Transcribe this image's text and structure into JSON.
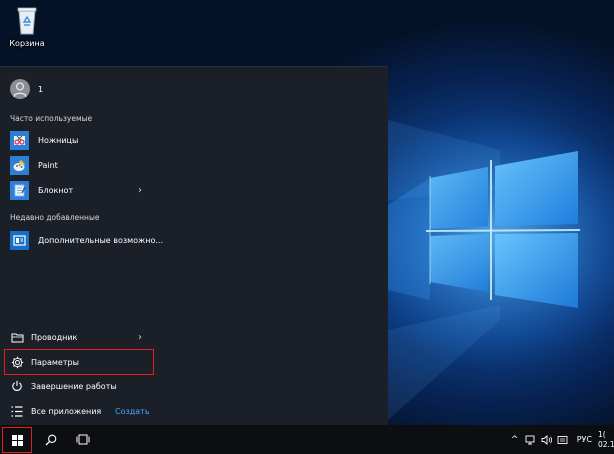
{
  "desktop": {
    "recycle_bin_label": "Корзина"
  },
  "start_menu": {
    "user_name": "1",
    "frequent": {
      "heading": "Часто используемые",
      "items": [
        {
          "label": "Ножницы",
          "icon": "scissors-icon",
          "has_submenu": false
        },
        {
          "label": "Paint",
          "icon": "paint-icon",
          "has_submenu": false
        },
        {
          "label": "Блокнот",
          "icon": "notepad-icon",
          "has_submenu": true
        }
      ]
    },
    "recent": {
      "heading": "Недавно добавленные",
      "items": [
        {
          "label": "Дополнительные возможно...",
          "icon": "app-window-icon"
        }
      ]
    },
    "bottom": {
      "explorer_label": "Проводник",
      "settings_label": "Параметры",
      "shutdown_label": "Завершение работы",
      "all_apps_label": "Все приложения",
      "create_label": "Создать"
    },
    "submenu_chevron": "›"
  },
  "taskbar": {
    "language": "РУС",
    "tray_expand": "^",
    "clock_time": "1(",
    "clock_date": "02.1"
  },
  "colors": {
    "menu_bg": "#1b1f27",
    "highlight": "#e01e1e",
    "accent_link": "#4aa3ff",
    "tile_blue": "#1670c9"
  }
}
